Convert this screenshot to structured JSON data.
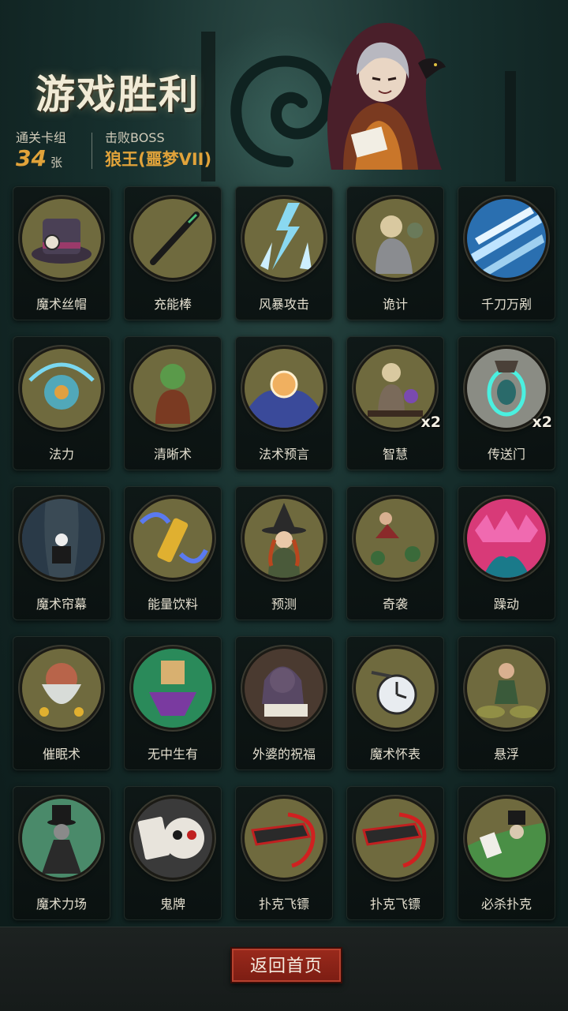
{
  "header": {
    "title": "游戏胜利",
    "deck_label": "通关卡组",
    "deck_count": "34",
    "deck_unit": "张",
    "boss_label": "击败BOSS",
    "boss_name": "狼王(噩梦VII)"
  },
  "cards": [
    {
      "name": "魔术丝帽",
      "icon": "top-hat-icon",
      "count": ""
    },
    {
      "name": "充能棒",
      "icon": "wand-icon",
      "count": ""
    },
    {
      "name": "风暴攻击",
      "icon": "lightning-icon",
      "count": ""
    },
    {
      "name": "诡计",
      "icon": "trickster-icon",
      "count": ""
    },
    {
      "name": "千刀万剐",
      "icon": "blades-icon",
      "count": ""
    },
    {
      "name": "法力",
      "icon": "mana-icon",
      "count": ""
    },
    {
      "name": "清晰术",
      "icon": "goblin-icon",
      "count": ""
    },
    {
      "name": "法术预言",
      "icon": "crystal-ball-icon",
      "count": ""
    },
    {
      "name": "智慧",
      "icon": "sage-icon",
      "count": "x2"
    },
    {
      "name": "传送门",
      "icon": "portal-icon",
      "count": "x2"
    },
    {
      "name": "魔术帘幕",
      "icon": "curtain-icon",
      "count": ""
    },
    {
      "name": "能量饮料",
      "icon": "potion-icon",
      "count": ""
    },
    {
      "name": "预测",
      "icon": "witch-icon",
      "count": ""
    },
    {
      "name": "奇袭",
      "icon": "ambush-icon",
      "count": ""
    },
    {
      "name": "躁动",
      "icon": "frenzy-icon",
      "count": ""
    },
    {
      "name": "催眠术",
      "icon": "hypnosis-icon",
      "count": ""
    },
    {
      "name": "无中生有",
      "icon": "summon-icon",
      "count": ""
    },
    {
      "name": "外婆的祝福",
      "icon": "grandma-icon",
      "count": ""
    },
    {
      "name": "魔术怀表",
      "icon": "pocket-watch-icon",
      "count": ""
    },
    {
      "name": "悬浮",
      "icon": "levitate-icon",
      "count": ""
    },
    {
      "name": "魔术力场",
      "icon": "magician-icon",
      "count": ""
    },
    {
      "name": "鬼牌",
      "icon": "joker-skull-icon",
      "count": ""
    },
    {
      "name": "扑克飞镖",
      "icon": "card-dart-icon",
      "count": ""
    },
    {
      "name": "扑克飞镖",
      "icon": "card-dart-icon",
      "count": ""
    },
    {
      "name": "必杀扑克",
      "icon": "killer-card-icon",
      "count": ""
    }
  ],
  "footer": {
    "return_label": "返回首页"
  },
  "colors": {
    "accent": "#e1a33a",
    "button": "#8f2518",
    "card_bg": "#0e1615",
    "art_bg": "#6f6a3e"
  }
}
